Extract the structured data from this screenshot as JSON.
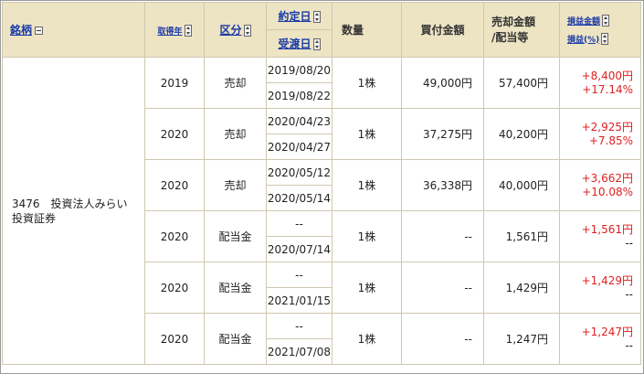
{
  "headers": {
    "security": "銘柄",
    "acquired_year": "取得年",
    "category": "区分",
    "trade_date": "約定日",
    "settlement_date": "受渡日",
    "quantity": "数量",
    "purchase_amount": "買付金額",
    "sale_amount_line1": "売却金額",
    "sale_amount_line2": "/配当等",
    "pl_amount": "損益金額",
    "pl_rate": "損益(%)"
  },
  "security_name_line1": "3476　投資法人みらい",
  "security_name_line2": "投資証券",
  "rows": [
    {
      "year": "2019",
      "type": "売却",
      "trade_date": "2019/08/20",
      "settle_date": "2019/08/22",
      "qty": "1株",
      "buy": "49,000円",
      "sell": "57,400円",
      "pl": "+8,400円",
      "pct": "+17.14%"
    },
    {
      "year": "2020",
      "type": "売却",
      "trade_date": "2020/04/23",
      "settle_date": "2020/04/27",
      "qty": "1株",
      "buy": "37,275円",
      "sell": "40,200円",
      "pl": "+2,925円",
      "pct": "+7.85%"
    },
    {
      "year": "2020",
      "type": "売却",
      "trade_date": "2020/05/12",
      "settle_date": "2020/05/14",
      "qty": "1株",
      "buy": "36,338円",
      "sell": "40,000円",
      "pl": "+3,662円",
      "pct": "+10.08%"
    },
    {
      "year": "2020",
      "type": "配当金",
      "trade_date": "--",
      "settle_date": "2020/07/14",
      "qty": "1株",
      "buy": "--",
      "sell": "1,561円",
      "pl": "+1,561円",
      "pct": "--"
    },
    {
      "year": "2020",
      "type": "配当金",
      "trade_date": "--",
      "settle_date": "2021/01/15",
      "qty": "1株",
      "buy": "--",
      "sell": "1,429円",
      "pl": "+1,429円",
      "pct": "--"
    },
    {
      "year": "2020",
      "type": "配当金",
      "trade_date": "--",
      "settle_date": "2021/07/08",
      "qty": "1株",
      "buy": "--",
      "sell": "1,247円",
      "pl": "+1,247円",
      "pct": "--"
    }
  ],
  "colors": {
    "header_bg": "#ede4c3",
    "link": "#1a3aa8",
    "profit": "#e02020",
    "border": "#cfc8b0"
  }
}
